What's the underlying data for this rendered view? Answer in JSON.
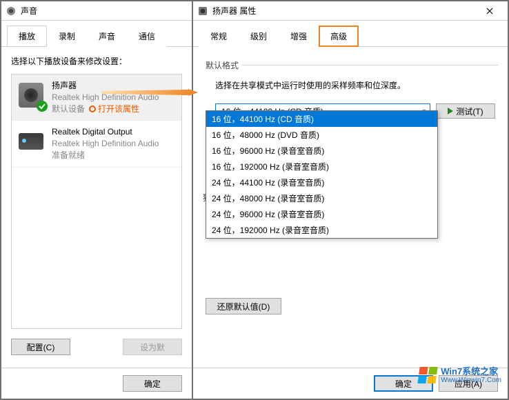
{
  "soundWindow": {
    "title": "声音",
    "tabs": [
      "播放",
      "录制",
      "声音",
      "通信"
    ],
    "activeTab": 0,
    "instruction": "选择以下播放设备来修改设置：",
    "devices": [
      {
        "name": "扬声器",
        "sub": "Realtek High Definition Audio",
        "status": "默认设备",
        "hint": "打开该属性",
        "default": true
      },
      {
        "name": "Realtek Digital Output",
        "sub": "Realtek High Definition Audio",
        "status": "准备就绪",
        "default": false
      }
    ],
    "configureBtn": "配置(C)",
    "setDefaultBtn": "设为默",
    "okBtn": "确定"
  },
  "propWindow": {
    "title": "扬声器 属性",
    "tabs": [
      "常规",
      "级别",
      "增强",
      "高级"
    ],
    "activeTab": 3,
    "group1": "默认格式",
    "description": "选择在共享模式中运行时使用的采样频率和位深度。",
    "selected": "16 位，44100 Hz (CD 音质)",
    "options": [
      "16 位，44100 Hz (CD 音质)",
      "16 位，48000 Hz (DVD 音质)",
      "16 位，96000 Hz (录音室音质)",
      "16 位，192000 Hz (录音室音质)",
      "24 位，44100 Hz (录音室音质)",
      "24 位，48000 Hz (录音室音质)",
      "24 位，96000 Hz (录音室音质)",
      "24 位，192000 Hz (录音室音质)"
    ],
    "testBtn": "测试(T)",
    "exclusiveGroup": "独",
    "restoreBtn": "还原默认值(D)",
    "okBtn": "确定",
    "applyBtn": "应用(A)"
  },
  "watermark": {
    "line1": "Win7系统之家",
    "line2": "Www.Winwin7.Com"
  }
}
